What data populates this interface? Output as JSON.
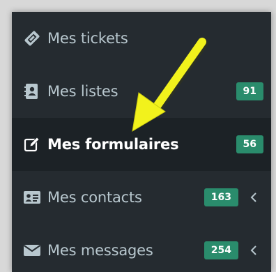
{
  "menu": {
    "items": [
      {
        "label": "Mes tickets",
        "icon": "ticket-icon",
        "badge": null,
        "has_chevron": false
      },
      {
        "label": "Mes listes",
        "icon": "address-book-icon",
        "badge": "91",
        "has_chevron": false
      },
      {
        "label": "Mes formulaires",
        "icon": "edit-form-icon",
        "badge": "56",
        "has_chevron": false,
        "active": true
      },
      {
        "label": "Mes contacts",
        "icon": "id-card-icon",
        "badge": "163",
        "has_chevron": true
      },
      {
        "label": "Mes messages",
        "icon": "envelope-icon",
        "badge": "254",
        "has_chevron": true
      }
    ]
  },
  "colors": {
    "sidebar_bg": "#252b30",
    "active_bg": "#1c2226",
    "text": "#b8c7ce",
    "active_text": "#ffffff",
    "badge_bg": "#2a8c6c",
    "annotation_arrow": "#f2f21c"
  },
  "annotation": {
    "type": "arrow",
    "points_to": "Mes formulaires"
  }
}
